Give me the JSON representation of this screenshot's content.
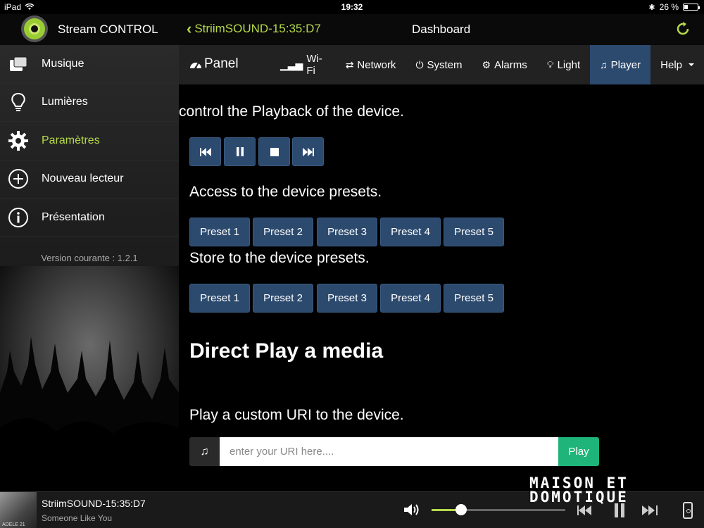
{
  "status_bar": {
    "device": "iPad",
    "time": "19:32",
    "battery_text": "26 %",
    "battery_level": 0.26
  },
  "header": {
    "app_title": "Stream CONTROL",
    "back_label": "StriimSOUND-15:35:D7",
    "page_title": "Dashboard",
    "accent_color": "#b6d94a"
  },
  "sidebar": {
    "items": [
      {
        "label": "Musique",
        "icon": "music-folder-icon"
      },
      {
        "label": "Lumières",
        "icon": "lightbulb-icon"
      },
      {
        "label": "Paramètres",
        "icon": "gear-icon",
        "active": true
      },
      {
        "label": "Nouveau lecteur",
        "icon": "plus-circle-icon"
      },
      {
        "label": "Présentation",
        "icon": "info-circle-icon"
      }
    ],
    "version": "Version courante : 1.2.1"
  },
  "navbar": {
    "brand": "Panel",
    "links": [
      {
        "label": "Wi-Fi",
        "icon": "signal-icon"
      },
      {
        "label": "Network",
        "icon": "transfer-icon"
      },
      {
        "label": "System",
        "icon": "power-icon"
      },
      {
        "label": "Alarms",
        "icon": "cogs-icon"
      },
      {
        "label": "Light",
        "icon": "bulb-icon"
      },
      {
        "label": "Player",
        "icon": "music-note-icon",
        "active": true
      },
      {
        "label": "Help",
        "icon": "caret-down-icon"
      }
    ],
    "active_color": "#2c4a6e"
  },
  "main": {
    "playback_text": "control the Playback of the device.",
    "playback_controls": [
      "previous",
      "pause",
      "stop",
      "next"
    ],
    "presets_access_text": "Access to the device presets.",
    "presets_access": [
      "Preset 1",
      "Preset 2",
      "Preset 3",
      "Preset 4",
      "Preset 5"
    ],
    "presets_store_text": "Store to the device presets.",
    "presets_store": [
      "Preset 1",
      "Preset 2",
      "Preset 3",
      "Preset 4",
      "Preset 5"
    ],
    "direct_play_title": "Direct Play a media",
    "uri_text": "Play a custom URI to the device.",
    "uri_placeholder": "enter your URI here....",
    "play_label": "Play",
    "play_color": "#1fb57a"
  },
  "player": {
    "album_caption": "ADELE 21",
    "device": "StriimSOUND-15:35:D7",
    "song": "Someone Like You",
    "volume": 0.22
  },
  "watermark": {
    "line1": "MAISON ET",
    "line2": "DOMOTIQUE"
  }
}
